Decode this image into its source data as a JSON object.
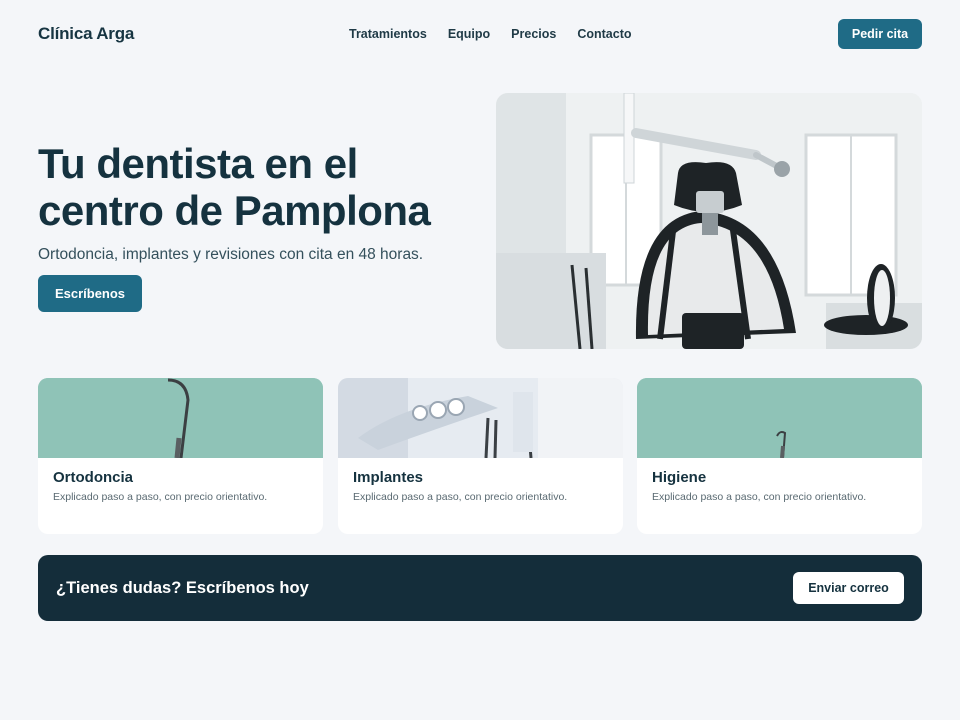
{
  "header": {
    "brand": "Clínica Arga",
    "nav": [
      "Tratamientos",
      "Equipo",
      "Precios",
      "Contacto"
    ],
    "cta": "Pedir cita"
  },
  "hero": {
    "title": "Tu dentista en el centro de Pamplona",
    "subtitle": "Ortodoncia, implantes y revisiones con cita en 48 horas.",
    "button": "Escríbenos"
  },
  "cards": [
    {
      "title": "Ortodoncia",
      "desc": "Explicado paso a paso, con precio orientativo."
    },
    {
      "title": "Implantes",
      "desc": "Explicado paso a paso, con precio orientativo."
    },
    {
      "title": "Higiene",
      "desc": "Explicado paso a paso, con precio orientativo."
    }
  ],
  "banner": {
    "text": "¿Tienes dudas? Escríbenos hoy",
    "button": "Enviar correo"
  },
  "colors": {
    "accent": "#1f6b86",
    "dark": "#142d3a",
    "mint": "#8fc3b7",
    "background": "#f4f6f9"
  }
}
